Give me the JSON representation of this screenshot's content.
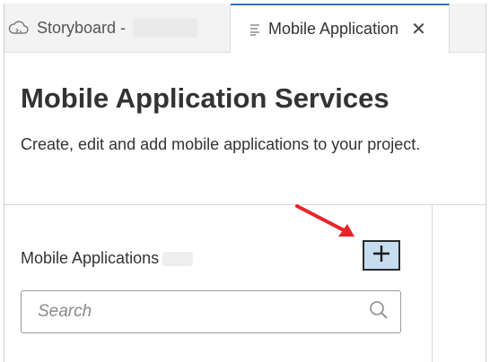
{
  "tabs": [
    {
      "label": "Storyboard -",
      "icon": "cloud-icon",
      "active": false
    },
    {
      "label": "Mobile Application",
      "icon": "document-icon",
      "active": true
    }
  ],
  "page": {
    "title": "Mobile Application Services",
    "subtitle": "Create, edit and add mobile applications to your project."
  },
  "section": {
    "label": "Mobile Applications",
    "add_button_icon": "plus-icon"
  },
  "search": {
    "placeholder": "Search",
    "value": ""
  },
  "annotation": {
    "arrow_color": "#e8232a"
  },
  "colors": {
    "tab_accent": "#2f6fb5",
    "add_button_bg": "#c6dcef"
  }
}
